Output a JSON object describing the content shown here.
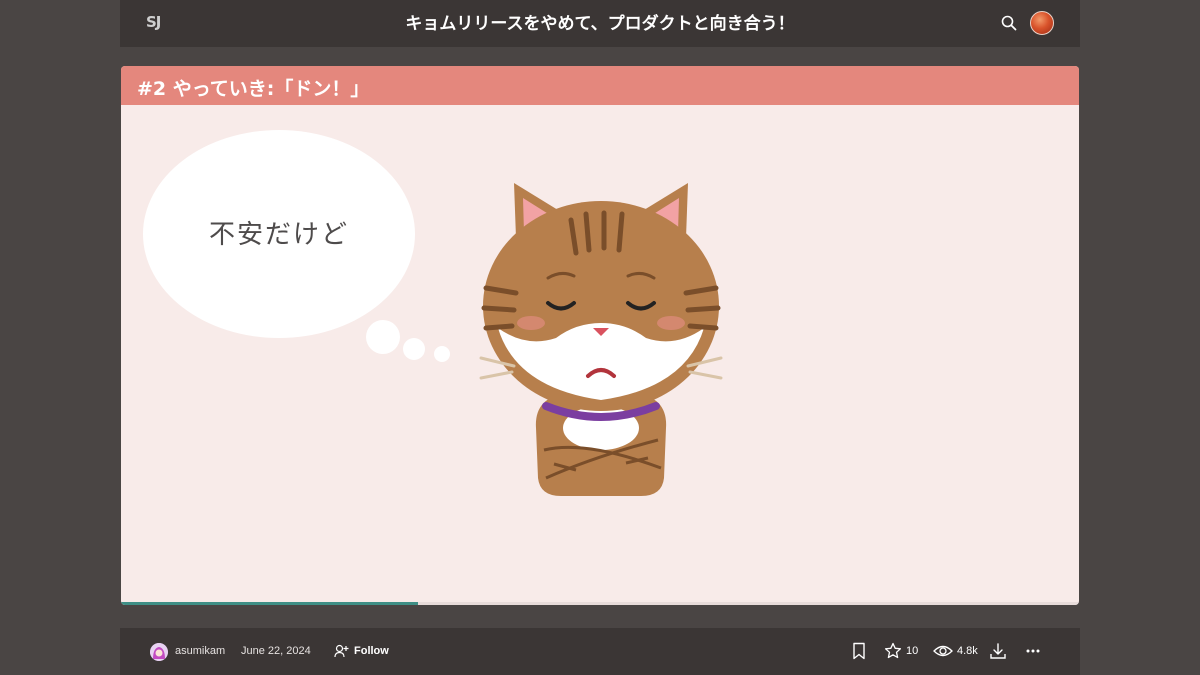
{
  "header": {
    "logo_text": "SJ",
    "deck_title": "キョムリリースをやめて、プロダクトと向き合う！",
    "search_icon": "search-icon",
    "avatar_icon": "user-avatar"
  },
  "slide": {
    "heading": "#2 やっていき:「ドン！」",
    "bubble_text": "不安だけど",
    "illustration": "cat-arms-crossed",
    "progress": 0.31,
    "colors": {
      "header_band": "#e4877d",
      "background": "#f8ebe9",
      "progress": "#3f8f86"
    }
  },
  "footer": {
    "author": "asumikam",
    "date": "June 22, 2024",
    "follow_label": "Follow",
    "stars_count": "10",
    "views_count": "4.8k"
  }
}
